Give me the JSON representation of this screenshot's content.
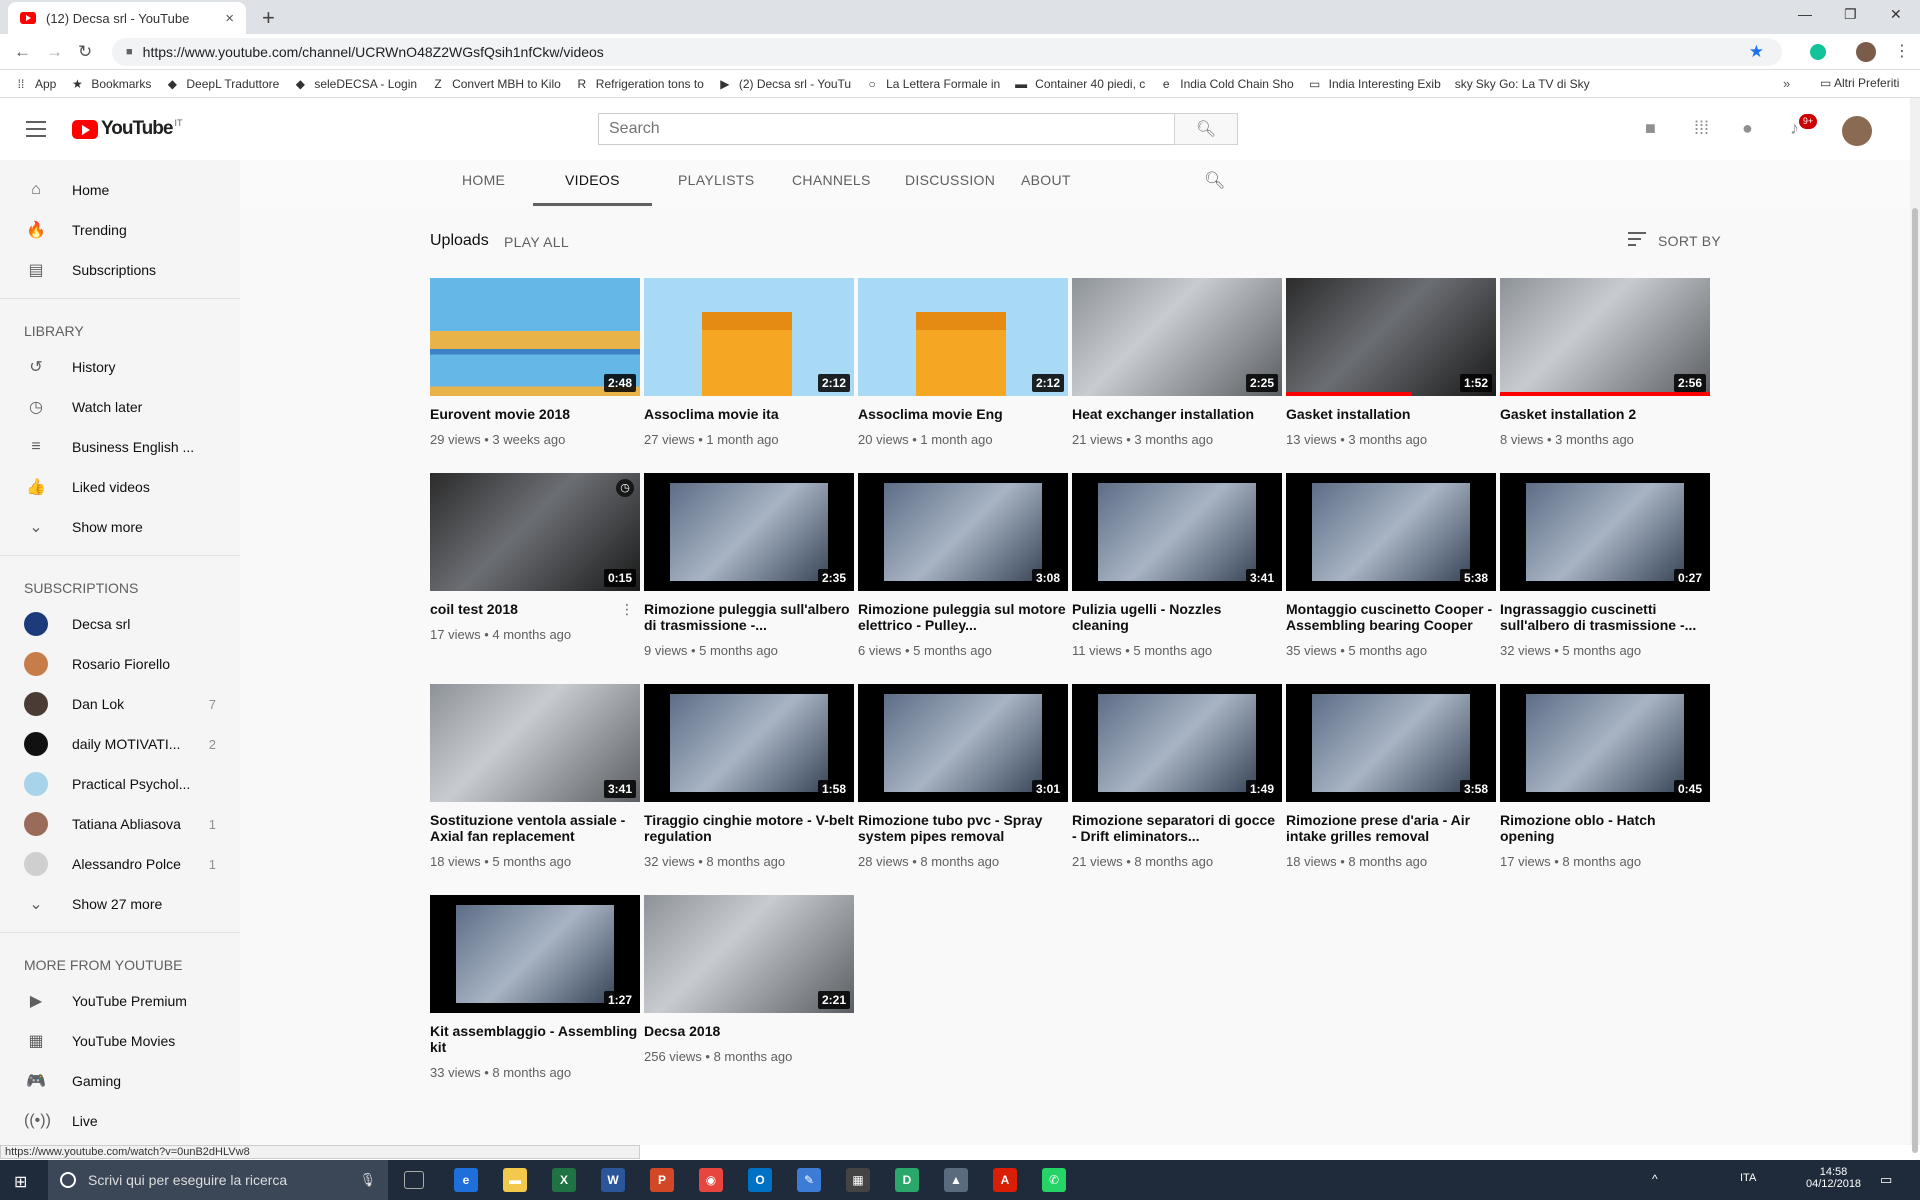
{
  "browser": {
    "tab_title": "(12) Decsa srl - YouTube",
    "tab_close": "×",
    "new_tab": "+",
    "url": "https://www.youtube.com/channel/UCRWnO48Z2WGsfQsih1nfCkw/videos",
    "window_controls": [
      "—",
      "❐",
      "✕"
    ],
    "bookmarks": [
      {
        "icon": "⁞⁞",
        "label": "App"
      },
      {
        "icon": "★",
        "label": "Bookmarks"
      },
      {
        "icon": "◆",
        "label": "DeepL Traduttore"
      },
      {
        "icon": "◆",
        "label": "seleDECSA - Login"
      },
      {
        "icon": "Z",
        "label": "Convert MBH to Kilo"
      },
      {
        "icon": "R",
        "label": "Refrigeration tons to"
      },
      {
        "icon": "▶",
        "label": "(2) Decsa srl - YouTu"
      },
      {
        "icon": "○",
        "label": "La Lettera Formale in"
      },
      {
        "icon": "▬",
        "label": "Container 40 piedi, c"
      },
      {
        "icon": "e",
        "label": "India Cold Chain Sho"
      },
      {
        "icon": "▭",
        "label": "India Interesting Exib"
      },
      {
        "icon": "sky",
        "label": "Sky Go: La TV di Sky"
      }
    ],
    "bookmarks_more": "»",
    "other_bookmarks": "Altri Preferiti",
    "status_url": "https://www.youtube.com/watch?v=0unB2dHLVw8"
  },
  "youtube": {
    "logo_text": "YouTube",
    "logo_country": "IT",
    "search_placeholder": "Search",
    "notification_count": "9+"
  },
  "sidebar": {
    "main": [
      {
        "icon": "home-icon",
        "glyph": "⌂",
        "label": "Home"
      },
      {
        "icon": "trending-icon",
        "glyph": "🔥",
        "label": "Trending"
      },
      {
        "icon": "subscriptions-icon",
        "glyph": "▤",
        "label": "Subscriptions"
      }
    ],
    "library_heading": "LIBRARY",
    "library": [
      {
        "icon": "history-icon",
        "glyph": "↺",
        "label": "History"
      },
      {
        "icon": "watch-later-icon",
        "glyph": "◷",
        "label": "Watch later"
      },
      {
        "icon": "playlist-icon",
        "glyph": "≡",
        "label": "Business English ..."
      },
      {
        "icon": "thumbs-up-icon",
        "glyph": "👍",
        "label": "Liked videos"
      },
      {
        "icon": "chevron-down-icon",
        "glyph": "⌄",
        "label": "Show more"
      }
    ],
    "subscriptions_heading": "SUBSCRIPTIONS",
    "subscriptions": [
      {
        "label": "Decsa srl",
        "count": "",
        "color": "#1d3a7a"
      },
      {
        "label": "Rosario Fiorello",
        "count": "",
        "color": "#c77d4a"
      },
      {
        "label": "Dan Lok",
        "count": "7",
        "color": "#4a3b35"
      },
      {
        "label": "daily MOTIVATI...",
        "count": "2",
        "color": "#111111"
      },
      {
        "label": "Practical Psychol...",
        "count": "",
        "color": "#a9d3ea"
      },
      {
        "label": "Tatiana Abliasova",
        "count": "1",
        "color": "#9a6b5a"
      },
      {
        "label": "Alessandro Polce",
        "count": "1",
        "color": "#cfcfcf"
      }
    ],
    "show_more_subs": "Show 27 more",
    "more_heading": "MORE FROM YOUTUBE",
    "more": [
      {
        "icon": "youtube-premium-icon",
        "glyph": "▶",
        "label": "YouTube Premium"
      },
      {
        "icon": "youtube-movies-icon",
        "glyph": "▦",
        "label": "YouTube Movies"
      },
      {
        "icon": "gaming-icon",
        "glyph": "🎮",
        "label": "Gaming"
      },
      {
        "icon": "live-icon",
        "glyph": "((•))",
        "label": "Live"
      }
    ]
  },
  "channel_nav": {
    "tabs": [
      "HOME",
      "VIDEOS",
      "PLAYLISTS",
      "CHANNELS",
      "DISCUSSION",
      "ABOUT"
    ],
    "active": "VIDEOS"
  },
  "uploads": {
    "title": "Uploads",
    "play_all": "PLAY ALL",
    "sort_by": "SORT BY"
  },
  "videos": [
    {
      "title": "Eurovent movie 2018",
      "meta": "29 views • 3 weeks ago",
      "duration": "2:48",
      "style": "sky",
      "watched": 0
    },
    {
      "title": "Assoclima movie ita",
      "meta": "27 views • 1 month ago",
      "duration": "2:12",
      "style": "build",
      "watched": 0
    },
    {
      "title": "Assoclima movie Eng",
      "meta": "20 views • 1 month ago",
      "duration": "2:12",
      "style": "build",
      "watched": 0
    },
    {
      "title": "Heat exchanger installation",
      "meta": "21 views • 3 months ago",
      "duration": "2:25",
      "style": "gray",
      "watched": 0
    },
    {
      "title": "Gasket installation",
      "meta": "13 views • 3 months ago",
      "duration": "1:52",
      "style": "dark",
      "watched": 0.6
    },
    {
      "title": "Gasket installation 2",
      "meta": "8 views • 3 months ago",
      "duration": "2:56",
      "style": "gray",
      "watched": 1
    },
    {
      "title": "coil test 2018",
      "meta": "17 views • 4 months ago",
      "duration": "0:15",
      "style": "dark",
      "watched": 0,
      "clock": true
    },
    {
      "title": "Rimozione puleggia sull'albero di trasmissione -...",
      "meta": "9 views • 5 months ago",
      "duration": "2:35",
      "style": "black",
      "watched": 0
    },
    {
      "title": "Rimozione puleggia sul motore elettrico - Pulley...",
      "meta": "6 views • 5 months ago",
      "duration": "3:08",
      "style": "black",
      "watched": 0
    },
    {
      "title": "Pulizia ugelli - Nozzles cleaning",
      "meta": "11 views • 5 months ago",
      "duration": "3:41",
      "style": "black",
      "watched": 0
    },
    {
      "title": "Montaggio cuscinetto Cooper - Assembling bearing Cooper",
      "meta": "35 views • 5 months ago",
      "duration": "5:38",
      "style": "black",
      "watched": 0
    },
    {
      "title": "Ingrassaggio cuscinetti sull'albero di trasmissione -...",
      "meta": "32 views • 5 months ago",
      "duration": "0:27",
      "style": "black",
      "watched": 0
    },
    {
      "title": "Sostituzione ventola assiale - Axial fan replacement",
      "meta": "18 views • 5 months ago",
      "duration": "3:41",
      "style": "gray",
      "watched": 0
    },
    {
      "title": "Tiraggio cinghie motore - V-belt regulation",
      "meta": "32 views • 8 months ago",
      "duration": "1:58",
      "style": "black",
      "watched": 0
    },
    {
      "title": "Rimozione tubo pvc - Spray system pipes removal",
      "meta": "28 views • 8 months ago",
      "duration": "3:01",
      "style": "black",
      "watched": 0
    },
    {
      "title": "Rimozione separatori di gocce - Drift eliminators...",
      "meta": "21 views • 8 months ago",
      "duration": "1:49",
      "style": "black",
      "watched": 0
    },
    {
      "title": "Rimozione prese d'aria - Air intake grilles removal",
      "meta": "18 views • 8 months ago",
      "duration": "3:58",
      "style": "black",
      "watched": 0
    },
    {
      "title": "Rimozione oblo - Hatch opening",
      "meta": "17 views • 8 months ago",
      "duration": "0:45",
      "style": "black",
      "watched": 0
    },
    {
      "title": "Kit assemblaggio - Assembling kit",
      "meta": "33 views • 8 months ago",
      "duration": "1:27",
      "style": "black",
      "watched": 0
    },
    {
      "title": "Decsa 2018",
      "meta": "256 views • 8 months ago",
      "duration": "2:21",
      "style": "gray",
      "watched": 0
    }
  ],
  "taskbar": {
    "search_placeholder": "Scrivi qui per eseguire la ricerca",
    "language": "ITA",
    "time": "14:58",
    "date": "04/12/2018",
    "apps": [
      {
        "label": "e",
        "color": "#1e6fd9",
        "name": "edge-icon"
      },
      {
        "label": "▬",
        "color": "#f2c94c",
        "name": "file-explorer-icon"
      },
      {
        "label": "X",
        "color": "#1f7244",
        "name": "excel-icon"
      },
      {
        "label": "W",
        "color": "#2b579a",
        "name": "word-icon"
      },
      {
        "label": "P",
        "color": "#d24726",
        "name": "powerpoint-icon"
      },
      {
        "label": "◉",
        "color": "#e8453c",
        "name": "chrome-icon"
      },
      {
        "label": "O",
        "color": "#0072c6",
        "name": "outlook-icon"
      },
      {
        "label": "✎",
        "color": "#3c7bd6",
        "name": "paint-icon"
      },
      {
        "label": "▦",
        "color": "#444444",
        "name": "calculator-icon"
      },
      {
        "label": "D",
        "color": "#2aa86b",
        "name": "d-app-icon"
      },
      {
        "label": "▲",
        "color": "#5b6b7f",
        "name": "photos-icon"
      },
      {
        "label": "A",
        "color": "#d81e05",
        "name": "acrobat-icon"
      },
      {
        "label": "✆",
        "color": "#25d366",
        "name": "whatsapp-icon"
      }
    ]
  }
}
